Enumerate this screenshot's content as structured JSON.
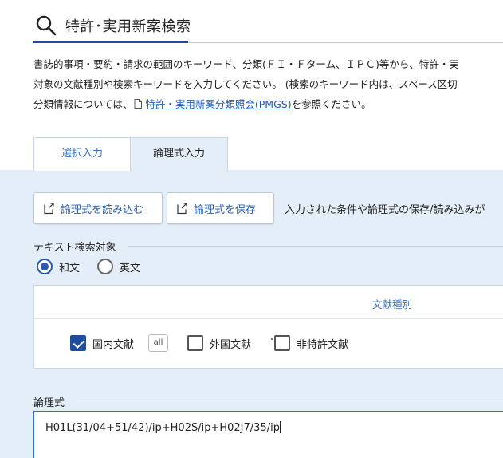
{
  "header": {
    "title": "特許･実用新案検索",
    "icon": "search-icon"
  },
  "description": {
    "line1": "書誌的事項・要約・請求の範囲のキーワード、分類(ＦＩ・Ｆターム、ＩＰＣ)等から、特許・実",
    "line2": "対象の文献種別や検索キーワードを入力してください。 (検索のキーワード内は、スペース区切",
    "line3_prefix": "分類情報については、",
    "line3_link": "特許・実用新案分類照会(PMGS)",
    "line3_suffix": "を参照ください。"
  },
  "tabs": {
    "select_input": "選択入力",
    "logic_input": "論理式入力",
    "active": "logic_input"
  },
  "buttons": {
    "load_label": "論理式を読み込む",
    "save_label": "論理式を保存",
    "note": "入力された条件や論理式の保存/読み込みが"
  },
  "text_target": {
    "title": "テキスト検索対象",
    "options": [
      "和文",
      "英文"
    ],
    "selected": "和文"
  },
  "doc_types": {
    "header": "文献種別",
    "all_label": "all",
    "items": [
      {
        "label": "国内文献",
        "checked": true
      },
      {
        "label": "外国文献",
        "checked": false
      },
      {
        "label": "非特許文献",
        "checked": false
      }
    ]
  },
  "logic": {
    "title": "論理式",
    "value": "H01L(31/04+51/42)/ip+H02S/ip+H02J7/35/ip"
  },
  "colors": {
    "accent": "#1f4d9e",
    "link": "#1f5bb5",
    "panel_bg": "#e3eef8"
  }
}
